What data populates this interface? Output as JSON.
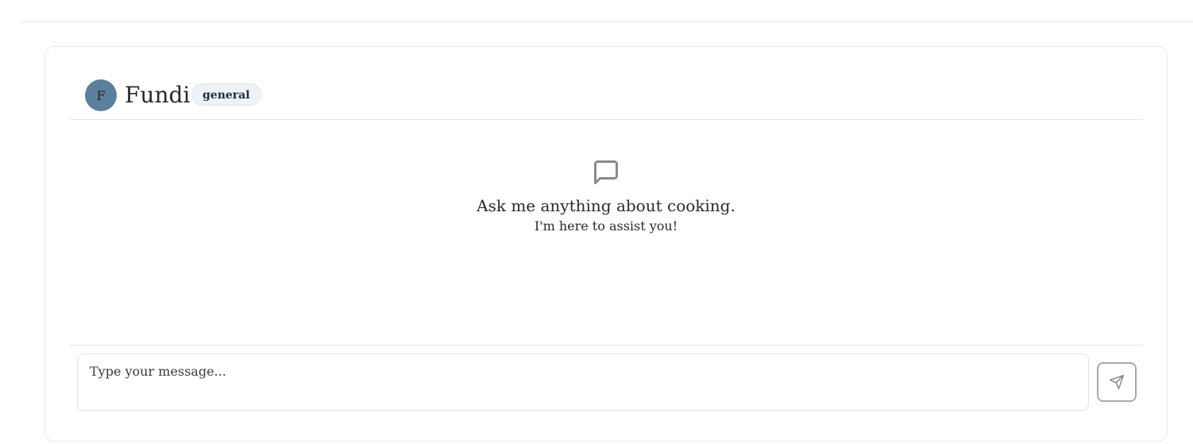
{
  "chat": {
    "bot_name": "Fundi",
    "avatar_letter": "F",
    "badge": "general",
    "empty_state": {
      "icon": "message-square-icon",
      "title": "Ask me anything about cooking.",
      "subtitle": "I'm here to assist you!"
    },
    "input": {
      "placeholder": "Type your message...",
      "value": ""
    },
    "send_icon": "send-icon"
  },
  "colors": {
    "avatar_bg": "#5c7f9c",
    "badge_bg": "#eef3fa",
    "card_border": "#f1e6e9"
  }
}
